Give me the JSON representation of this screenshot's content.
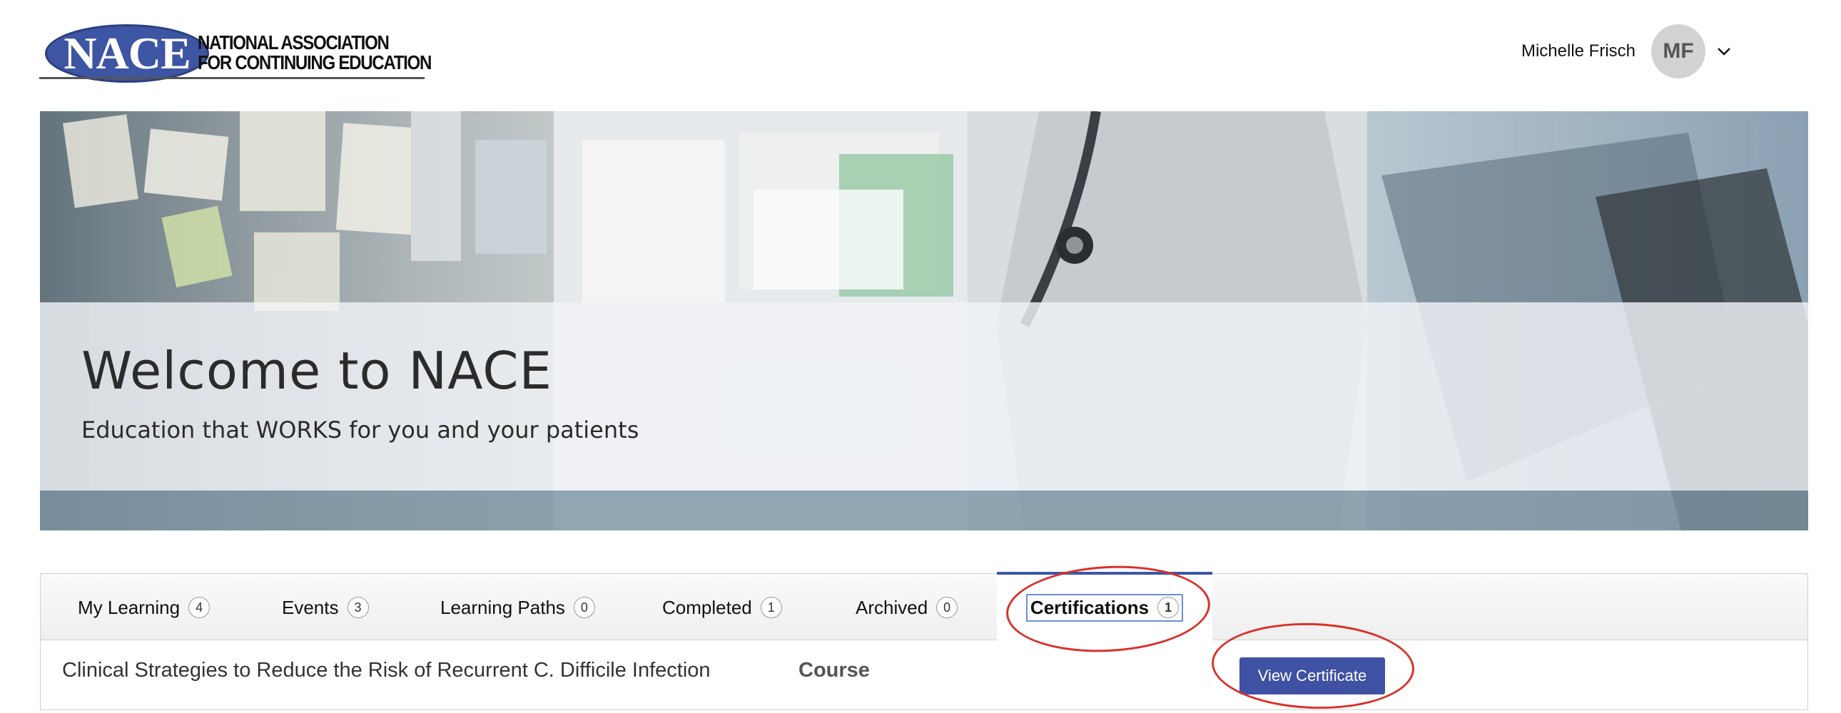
{
  "header": {
    "logo": {
      "mark": "NACE",
      "line1": "NATIONAL ASSOCIATION",
      "line2": "FOR CONTINUING EDUCATION"
    },
    "user": {
      "name": "Michelle Frisch",
      "initials": "MF"
    },
    "icons": {
      "user_menu": "chevron-down-icon"
    }
  },
  "hero": {
    "title": "Welcome to NACE",
    "subtitle": "Education that WORKS for you and your patients"
  },
  "tabs": [
    {
      "label": "My Learning",
      "count": "4"
    },
    {
      "label": "Events",
      "count": "3"
    },
    {
      "label": "Learning Paths",
      "count": "0"
    },
    {
      "label": "Completed",
      "count": "1"
    },
    {
      "label": "Archived",
      "count": "0"
    },
    {
      "label": "Certifications",
      "count": "1",
      "active": true
    }
  ],
  "certifications": {
    "rows": [
      {
        "title": "Clinical Strategies to Reduce the Risk of Recurrent C. Difficile Infection",
        "type": "Course",
        "action_label": "View Certificate"
      }
    ]
  },
  "colors": {
    "brand": "#3d55a3",
    "button": "#3f51a3",
    "annotation": "#d8322a"
  }
}
